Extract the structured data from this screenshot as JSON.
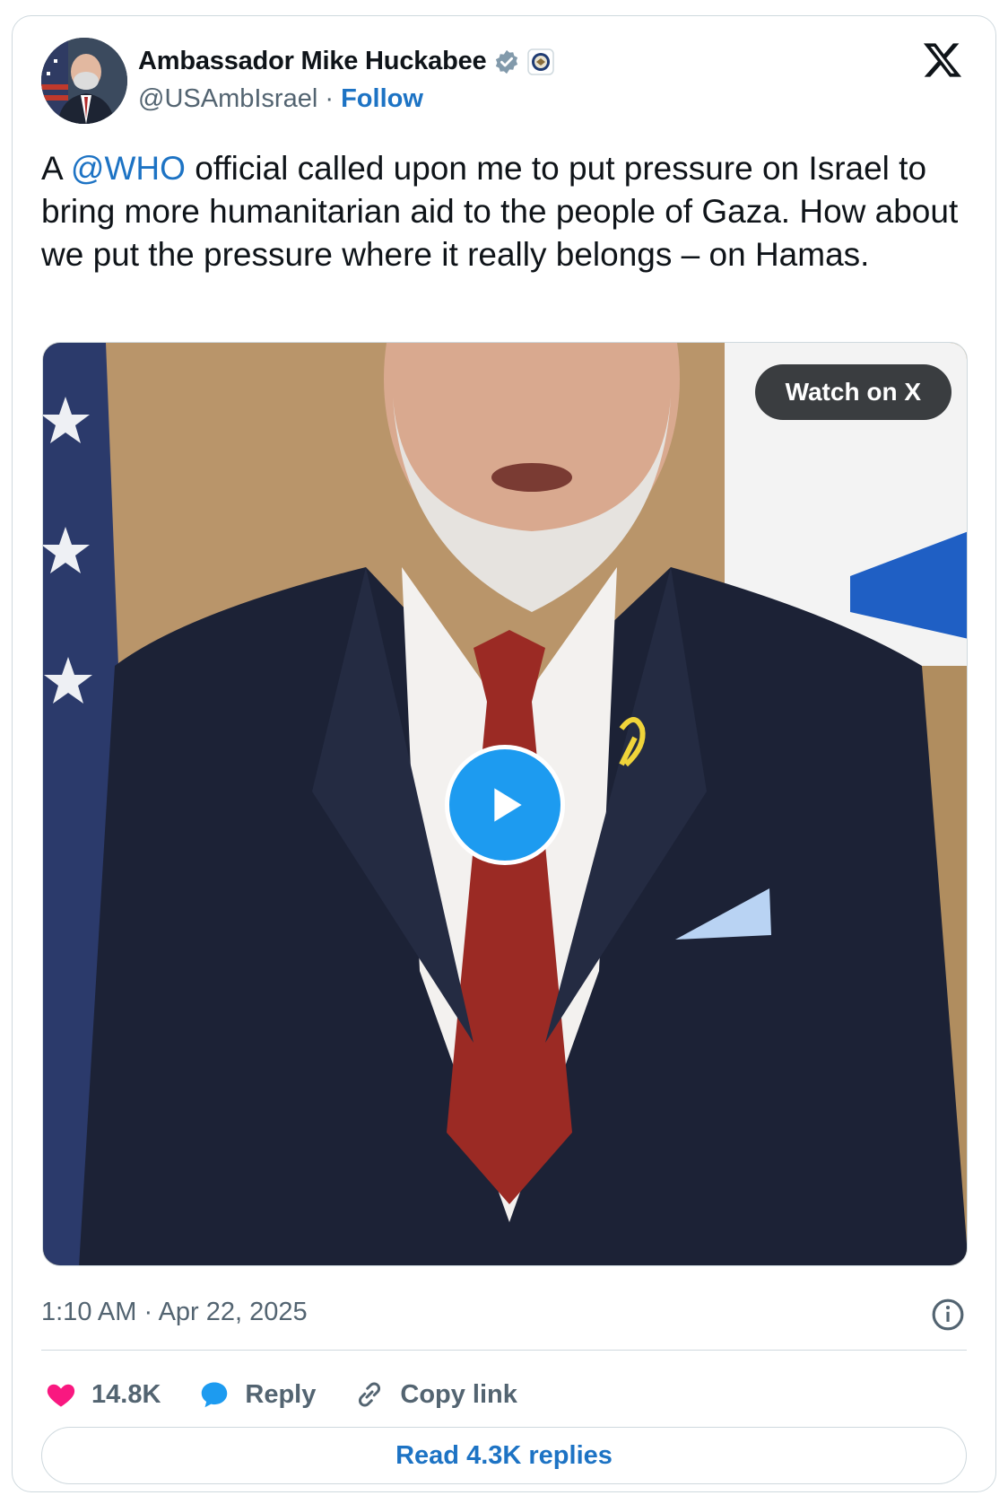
{
  "author": {
    "name": "Ambassador Mike Huckabee",
    "handle": "@USAmbIsrael",
    "separator": "·",
    "follow_label": "Follow",
    "verified_badge": "verified-badge-icon",
    "affiliate_badge": "state-department-seal-icon"
  },
  "tweet": {
    "prefix": "A",
    "mention": "@WHO",
    "body": "official called upon me to put pressure on Israel to bring more humanitarian aid to the people of Gaza. How about we put the pressure where it really belongs – on Hamas."
  },
  "media": {
    "watch_label": "Watch on X",
    "play_icon": "play-icon"
  },
  "meta": {
    "timestamp": "1:10 AM · Apr 22, 2025"
  },
  "actions": {
    "likes": "14.8K",
    "reply_label": "Reply",
    "copy_label": "Copy link"
  },
  "footer": {
    "read_replies_label": "Read 4.3K replies"
  },
  "colors": {
    "link": "#1d73c4",
    "like": "#f91880",
    "reply": "#1d9bf0",
    "play": "#1d9bf0"
  }
}
